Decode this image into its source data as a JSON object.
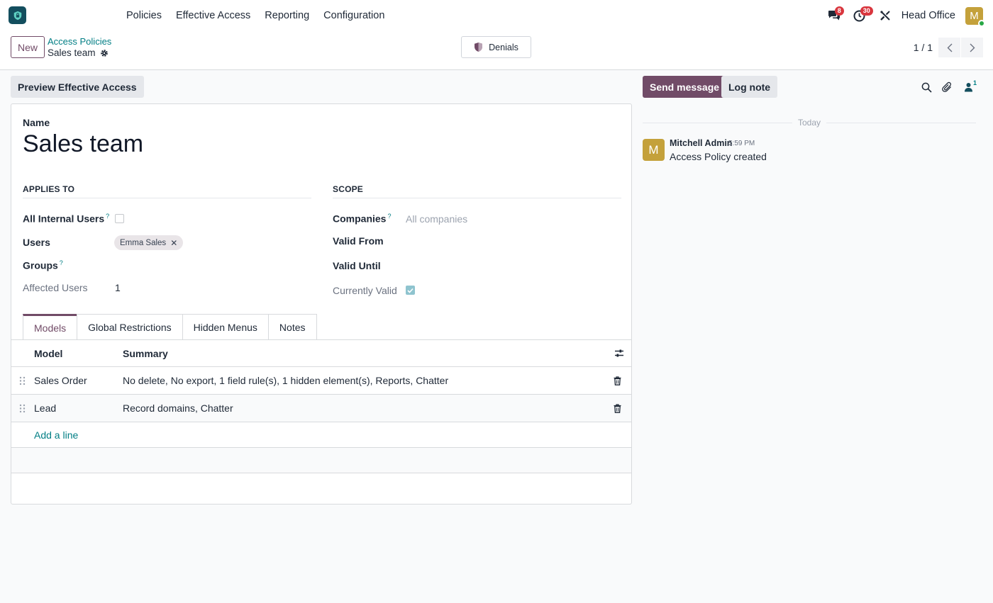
{
  "navbar": {
    "app_icon": "access-policies-app-icon",
    "menu": [
      "Policies",
      "Effective Access",
      "Reporting",
      "Configuration"
    ],
    "messages_badge": "8",
    "activities_badge": "30",
    "company": "Head Office",
    "user_initial": "M"
  },
  "control_panel": {
    "new_label": "New",
    "breadcrumb_parent": "Access Policies",
    "breadcrumb_current": "Sales team",
    "denials_label": "Denials",
    "pager": "1 / 1"
  },
  "form": {
    "preview_button": "Preview Effective Access",
    "name_label": "Name",
    "name_value": "Sales team",
    "applies_to_title": "APPLIES TO",
    "scope_title": "SCOPE",
    "all_internal_users_label": "All Internal Users",
    "all_internal_users_checked": false,
    "users_label": "Users",
    "users_tags": [
      "Emma Sales"
    ],
    "groups_label": "Groups",
    "affected_users_label": "Affected Users",
    "affected_users_value": "1",
    "companies_label": "Companies",
    "companies_placeholder": "All companies",
    "valid_from_label": "Valid From",
    "valid_until_label": "Valid Until",
    "currently_valid_label": "Currently Valid",
    "currently_valid_checked": true,
    "help_marker": "?"
  },
  "tabs": [
    {
      "label": "Models",
      "active": true
    },
    {
      "label": "Global Restrictions",
      "active": false
    },
    {
      "label": "Hidden Menus",
      "active": false
    },
    {
      "label": "Notes",
      "active": false
    }
  ],
  "table": {
    "headers": [
      "Model",
      "Summary"
    ],
    "rows": [
      {
        "model": "Sales Order",
        "summary": "No delete, No export, 1 field rule(s), 1 hidden element(s), Reports, Chatter"
      },
      {
        "model": "Lead",
        "summary": "Record domains, Chatter"
      }
    ],
    "add_line": "Add a line"
  },
  "chatter": {
    "send_message": "Send message",
    "log_note": "Log note",
    "followers_count": "1",
    "day_separator": "Today",
    "message": {
      "author": "Mitchell Admin",
      "time": "5:59 PM",
      "body": "Access Policy created",
      "avatar_initial": "M"
    }
  },
  "colors": {
    "brand": "#714b67",
    "link": "#017e84",
    "badge": "#d9363e",
    "avatar": "#c4a13b"
  }
}
